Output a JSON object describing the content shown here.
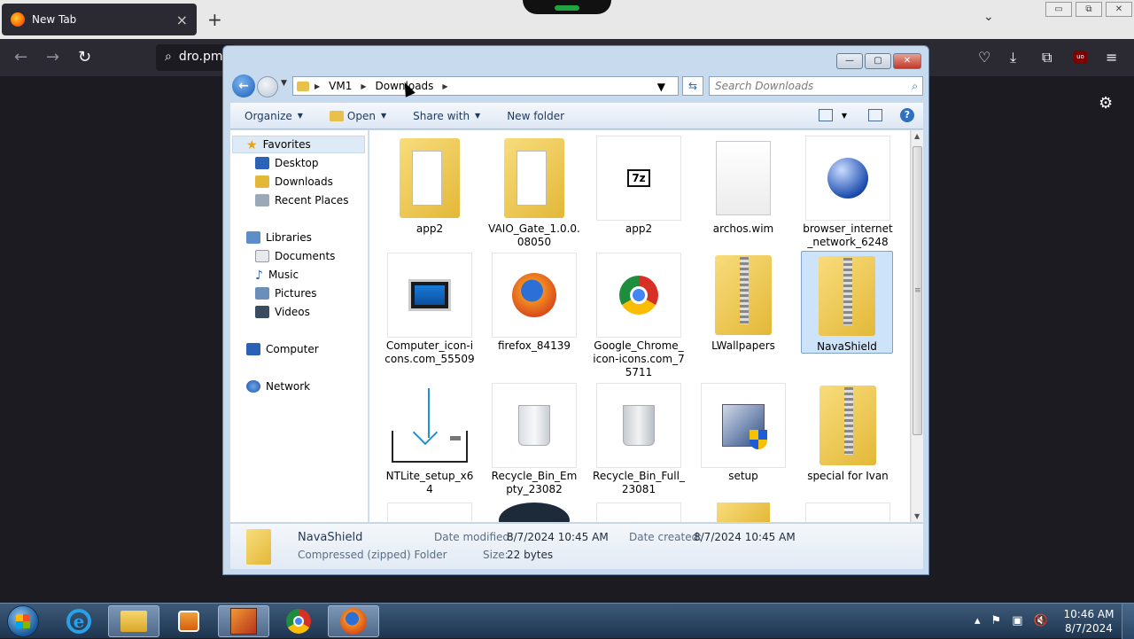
{
  "browser": {
    "tab_title": "New Tab",
    "tab_close": "×",
    "new_tab": "+",
    "tabs_chevron": "⌄",
    "url_text": "dro.pm",
    "window_controls": [
      "▭",
      "⧉",
      "✕"
    ]
  },
  "explorer": {
    "title_controls": [
      "—",
      "▢",
      "✕"
    ],
    "breadcrumb": [
      "VM1",
      "Downloads"
    ],
    "search_placeholder": "Search Downloads",
    "toolbar": {
      "organize": "Organize",
      "open": "Open",
      "share_with": "Share with",
      "new_folder": "New folder"
    },
    "nav": {
      "favorites": "Favorites",
      "desktop": "Desktop",
      "downloads": "Downloads",
      "recent_places": "Recent Places",
      "libraries": "Libraries",
      "documents": "Documents",
      "music": "Music",
      "pictures": "Pictures",
      "videos": "Videos",
      "computer": "Computer",
      "network": "Network"
    },
    "files": [
      {
        "name": "app2",
        "icon": "folder-icon"
      },
      {
        "name": "VAIO_Gate_1.0.0.08050",
        "icon": "folder-icon"
      },
      {
        "name": "app2",
        "icon": "7z-archive-icon"
      },
      {
        "name": "archos.wim",
        "icon": "file-icon"
      },
      {
        "name": "browser_internet_network_6248",
        "icon": "globe-icon"
      },
      {
        "name": "Computer_icon-icons.com_55509",
        "icon": "monitor-icon"
      },
      {
        "name": "firefox_84139",
        "icon": "firefox-icon"
      },
      {
        "name": "Google_Chrome_icon-icons.com_75711",
        "icon": "chrome-icon"
      },
      {
        "name": "LWallpapers",
        "icon": "zip-folder-icon"
      },
      {
        "name": "NavaShield",
        "icon": "zip-folder-icon"
      },
      {
        "name": "NTLite_setup_x64",
        "icon": "download-icon"
      },
      {
        "name": "Recycle_Bin_Empty_23082",
        "icon": "recycle-bin-empty-icon"
      },
      {
        "name": "Recycle_Bin_Full_23081",
        "icon": "recycle-bin-full-icon"
      },
      {
        "name": "setup",
        "icon": "setup-shield-icon"
      },
      {
        "name": "special for Ivan",
        "icon": "zip-folder-icon"
      }
    ],
    "details": {
      "name": "NavaShield",
      "type": "Compressed (zipped) Folder",
      "date_modified_label": "Date modified:",
      "date_modified": "8/7/2024 10:45 AM",
      "date_created_label": "Date created:",
      "date_created": "8/7/2024 10:45 AM",
      "size_label": "Size:",
      "size": "22 bytes"
    }
  },
  "taskbar": {
    "time": "10:46 AM",
    "date": "8/7/2024"
  }
}
